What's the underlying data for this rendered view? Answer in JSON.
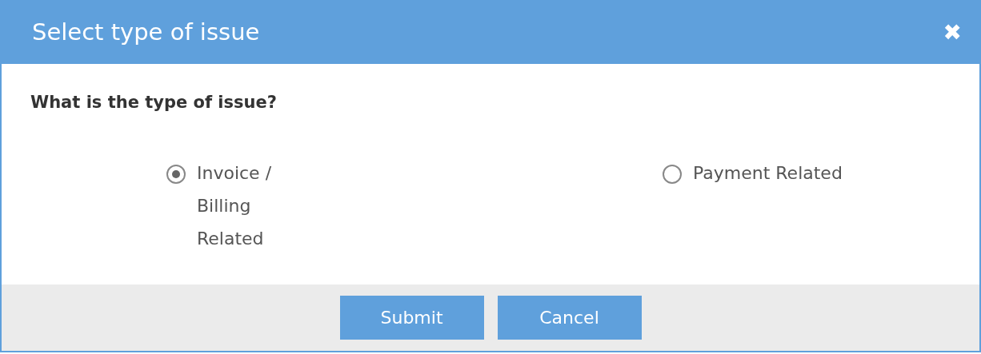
{
  "window": {
    "title": "Select type of issue",
    "close": "✖"
  },
  "question": "What is the type of issue?",
  "options": [
    {
      "label": "Invoice / Billing Related",
      "selected": true
    },
    {
      "label": "Payment Related",
      "selected": false
    }
  ],
  "buttons": [
    "Submit",
    "Cancel"
  ]
}
